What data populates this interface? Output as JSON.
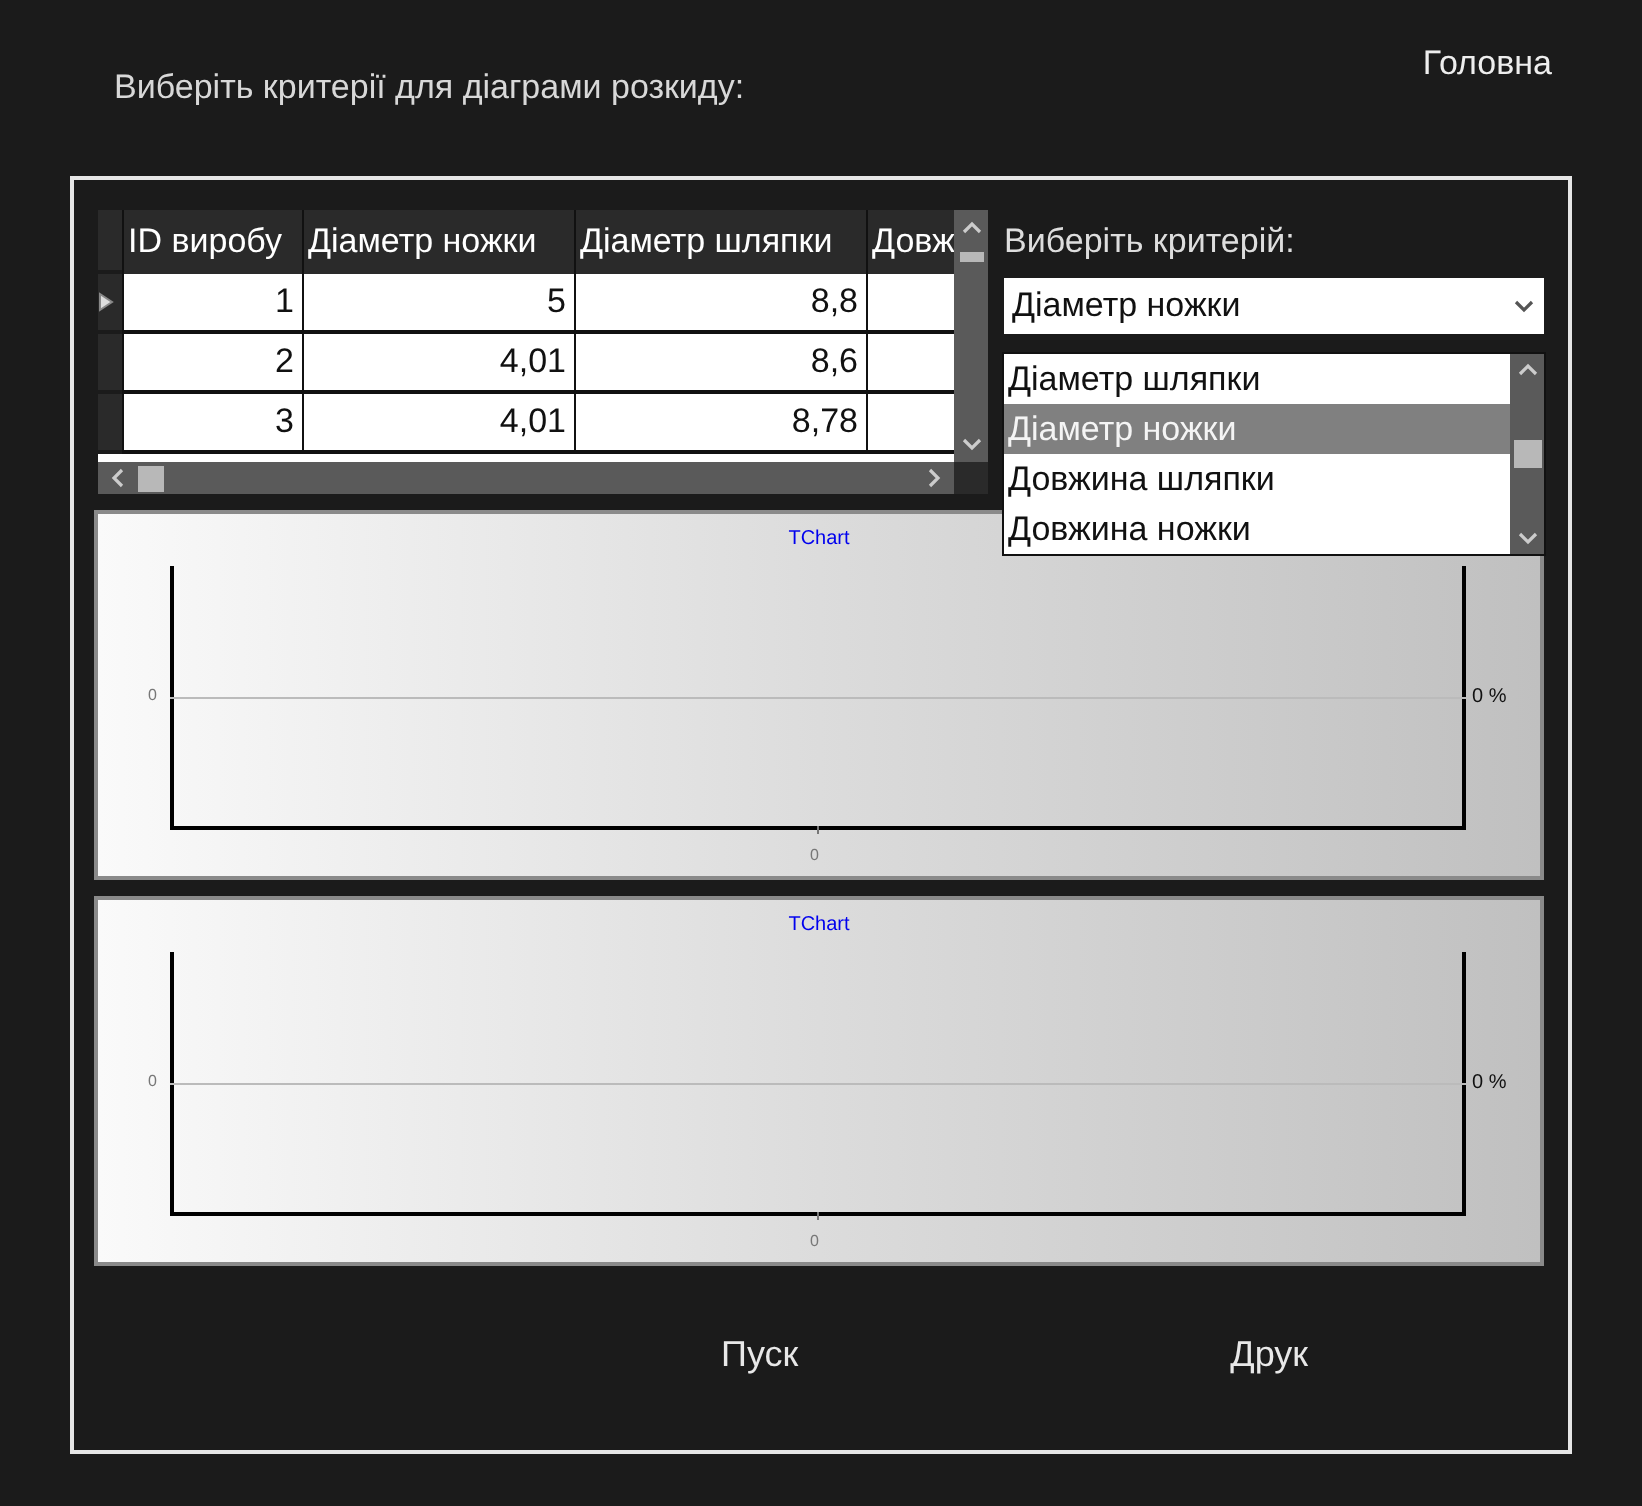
{
  "prompt": "Виберіть критерії для діаграми розкиду:",
  "home_link": "Головна",
  "grid": {
    "columns": [
      "ID виробу",
      "Діаметр ножки",
      "Діаметр шляпки",
      "Довж"
    ],
    "rows": [
      {
        "current": true,
        "cells": [
          "1",
          "5",
          "8,8",
          ""
        ]
      },
      {
        "current": false,
        "cells": [
          "2",
          "4,01",
          "8,6",
          ""
        ]
      },
      {
        "current": false,
        "cells": [
          "3",
          "4,01",
          "8,78",
          ""
        ]
      }
    ]
  },
  "criterion": {
    "label": "Виберіть критерій:",
    "value": "Діаметр ножки",
    "expanded": true,
    "options": [
      {
        "label": "Діаметр шляпки",
        "selected": false
      },
      {
        "label": "Діаметр ножки",
        "selected": true
      },
      {
        "label": "Довжина шляпки",
        "selected": false
      },
      {
        "label": "Довжина ножки",
        "selected": false
      }
    ]
  },
  "charts": [
    {
      "title": "TChart",
      "left_tick": "0",
      "bottom_tick": "0",
      "right_label": "0 %"
    },
    {
      "title": "TChart",
      "left_tick": "0",
      "bottom_tick": "0",
      "right_label": "0 %"
    }
  ],
  "buttons": [
    "Пуск",
    "Друк"
  ]
}
